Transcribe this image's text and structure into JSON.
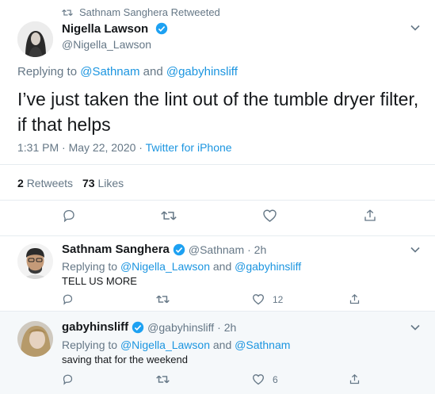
{
  "main_tweet": {
    "retweeted_by": "Sathnam Sanghera Retweeted",
    "author_name": "Nigella Lawson",
    "author_handle": "@Nigella_Lawson",
    "replying_prefix": "Replying to",
    "replying_to_1": "@Sathnam",
    "replying_and": "and",
    "replying_to_2": "@gabyhinsliff",
    "text": "I’ve just taken the lint out of the tumble dryer filter, if that helps",
    "time_date": "1:31 PM · May 22, 2020 · ",
    "source": "Twitter for iPhone",
    "retweets_count": "2",
    "retweets_label": "Retweets",
    "likes_count": "73",
    "likes_label": "Likes"
  },
  "replies": [
    {
      "author_name": "Sathnam Sanghera",
      "author_handle": "@Sathnam",
      "time": "· 2h",
      "replying_prefix": "Replying to",
      "replying_to_1": "@Nigella_Lawson",
      "replying_and": "and",
      "replying_to_2": "@gabyhinsliff",
      "text": "TELL US MORE",
      "like_count": "12"
    },
    {
      "author_name": "gabyhinsliff",
      "author_handle": "@gabyhinsliff",
      "time": "· 2h",
      "replying_prefix": "Replying to",
      "replying_to_1": "@Nigella_Lawson",
      "replying_and": "and",
      "replying_to_2": "@Sathnam",
      "text": "saving that for the weekend",
      "like_count": "6"
    }
  ],
  "colors": {
    "link": "#1b95e0",
    "verified": "#1da1f2",
    "secondary_text": "#657786",
    "divider": "#e6ecf0",
    "highlight_bg": "#f5f8fa"
  },
  "icons": [
    "retweet-icon",
    "verified-icon",
    "chevron-down-icon",
    "reply-icon",
    "heart-icon",
    "share-icon"
  ]
}
